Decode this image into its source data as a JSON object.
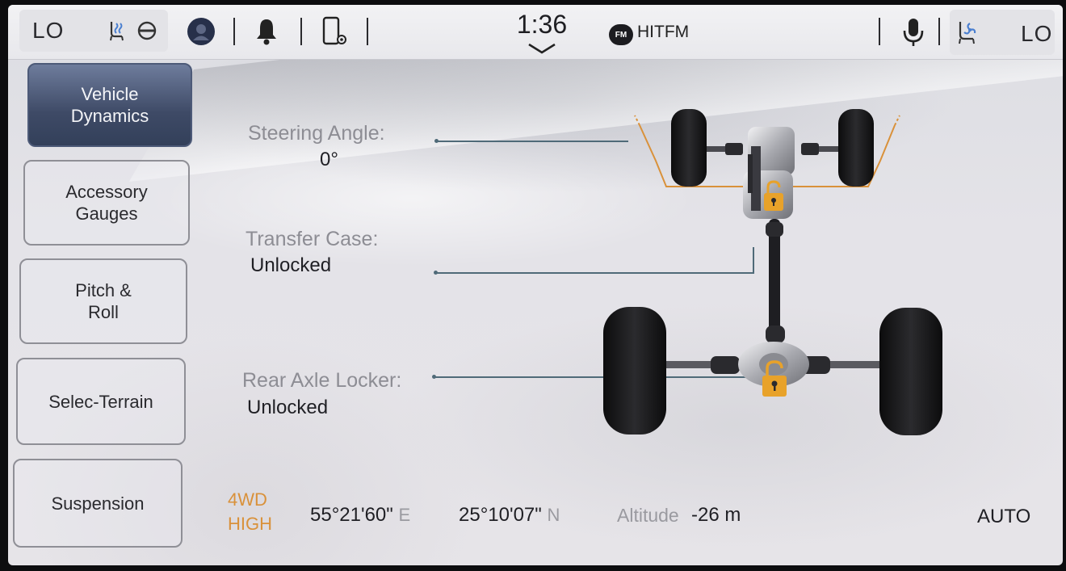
{
  "status_bar": {
    "left_temp": "LO",
    "right_temp": "LO",
    "clock": "1:36",
    "radio_badge": "FM",
    "radio_station": "HITFM",
    "icons": [
      "heated-seat-icon",
      "heated-steering-icon",
      "profile-icon",
      "notification-bell-icon",
      "phone-settings-icon",
      "microphone-icon",
      "seat-fan-icon",
      "chevron-down-icon"
    ]
  },
  "menu": {
    "items": [
      {
        "label": "Vehicle\nDynamics",
        "active": true
      },
      {
        "label": "Accessory\nGauges",
        "active": false
      },
      {
        "label": "Pitch &\nRoll",
        "active": false
      },
      {
        "label": "Selec-Terrain",
        "active": false
      },
      {
        "label": "Suspension",
        "active": false
      }
    ]
  },
  "dynamics": {
    "steering_angle_label": "Steering Angle:",
    "steering_angle_value": "0°",
    "transfer_case_label": "Transfer Case:",
    "transfer_case_value": "Unlocked",
    "rear_axle_label": "Rear Axle Locker:",
    "rear_axle_value": "Unlocked"
  },
  "bottom": {
    "drive_mode_line1": "4WD",
    "drive_mode_line2": "HIGH",
    "longitude": "55°21'60\"",
    "longitude_dir": "E",
    "latitude": "25°10'07\"",
    "latitude_dir": "N",
    "altitude_label": "Altitude",
    "altitude_value": "-26 m",
    "mode": "AUTO"
  },
  "colors": {
    "accent_orange": "#d9913a",
    "lock_yellow": "#e8a22a",
    "active_menu": "#3e4a66",
    "leader_line": "#4f6a78"
  }
}
